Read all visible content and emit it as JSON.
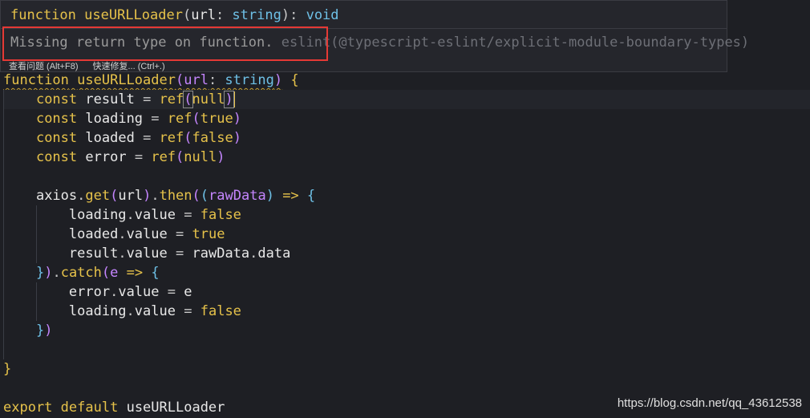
{
  "hover": {
    "signature": {
      "keyword": "function",
      "name": "useURLLoader",
      "open": "(",
      "param": "url",
      "colon": ": ",
      "param_type": "string",
      "close": ")",
      "ret_colon": ": ",
      "ret_type": "void"
    },
    "message": "Missing return type on function.",
    "source": "eslint(@typescript-eslint/explicit-module-boundary-types)",
    "actions": [
      "查看问题 (Alt+F8)",
      "快速修复... (Ctrl+.)"
    ]
  },
  "code": {
    "l1": {
      "kw": "function",
      "name": "useURLLoader",
      "param": "url",
      "type": "string"
    },
    "l2": {
      "kw": "const",
      "var": "result",
      "fn": "ref",
      "arg": "null"
    },
    "l3": {
      "kw": "const",
      "var": "loading",
      "fn": "ref",
      "arg": "true"
    },
    "l4": {
      "kw": "const",
      "var": "loaded",
      "fn": "ref",
      "arg": "false"
    },
    "l5": {
      "kw": "const",
      "var": "error",
      "fn": "ref",
      "arg": "null"
    },
    "l7": {
      "obj": "axios",
      "get": "get",
      "arg": "url",
      "then": "then",
      "param": "rawData"
    },
    "l8": {
      "obj": "loading",
      "prop": "value",
      "val": "false"
    },
    "l9": {
      "obj": "loaded",
      "prop": "value",
      "val": "true"
    },
    "l10": {
      "obj": "result",
      "prop": "value",
      "rhs_obj": "rawData",
      "rhs_prop": "data"
    },
    "l11": {
      "fn": "catch",
      "param": "e"
    },
    "l12": {
      "obj": "error",
      "prop": "value",
      "val": "e"
    },
    "l13": {
      "obj": "loading",
      "prop": "value",
      "val": "false"
    },
    "l18": {
      "kw1": "export",
      "kw2": "default",
      "name": "useURLLoader"
    }
  },
  "colors": {
    "background": "#1e1f24",
    "keyword": "#e6c24a",
    "type": "#6ec0e6",
    "param": "#c586ff",
    "highlight_box": "#e53935"
  },
  "watermark": "https://blog.csdn.net/qq_43612538"
}
